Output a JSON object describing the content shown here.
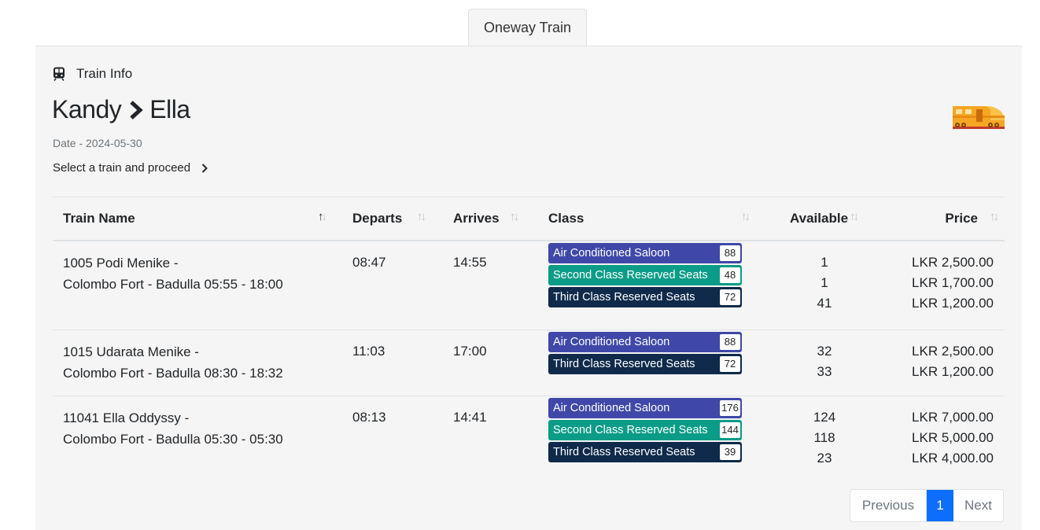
{
  "tab": {
    "label": "Oneway Train"
  },
  "info": {
    "title": "Train Info",
    "from": "Kandy",
    "to": "Ella",
    "date": "Date - 2024-05-30",
    "proceed": "Select a train and proceed"
  },
  "table": {
    "headers": {
      "train_name": "Train Name",
      "departs": "Departs",
      "arrives": "Arrives",
      "class": "Class",
      "available": "Available",
      "price": "Price"
    },
    "rows": [
      {
        "name_line1": "1005 Podi Menike -",
        "name_line2": "Colombo Fort - Badulla 05:55 - 18:00",
        "departs": "08:47",
        "arrives": "14:55",
        "classes": [
          {
            "name": "Air Conditioned Saloon",
            "count": "88",
            "color": "#3f48a8",
            "available": "1",
            "price": "LKR 2,500.00"
          },
          {
            "name": "Second Class Reserved Seats",
            "count": "48",
            "color": "#0b9c87",
            "available": "1",
            "price": "LKR 1,700.00"
          },
          {
            "name": "Third Class Reserved Seats",
            "count": "72",
            "color": "#0f2a4a",
            "available": "41",
            "price": "LKR 1,200.00"
          }
        ]
      },
      {
        "name_line1": "1015 Udarata Menike -",
        "name_line2": "Colombo Fort - Badulla 08:30 - 18:32",
        "departs": "11:03",
        "arrives": "17:00",
        "classes": [
          {
            "name": "Air Conditioned Saloon",
            "count": "88",
            "color": "#3f48a8",
            "available": "32",
            "price": "LKR 2,500.00"
          },
          {
            "name": "Third Class Reserved Seats",
            "count": "72",
            "color": "#0f2a4a",
            "available": "33",
            "price": "LKR 1,200.00"
          }
        ]
      },
      {
        "name_line1": "11041 Ella Oddyssy -",
        "name_line2": "Colombo Fort - Badulla 05:30 - 05:30",
        "departs": "08:13",
        "arrives": "14:41",
        "classes": [
          {
            "name": "Air Conditioned Saloon",
            "count": "176",
            "color": "#3f48a8",
            "available": "124",
            "price": "LKR 7,000.00"
          },
          {
            "name": "Second Class Reserved Seats",
            "count": "144",
            "color": "#0b9c87",
            "available": "118",
            "price": "LKR 5,000.00"
          },
          {
            "name": "Third Class Reserved Seats",
            "count": "39",
            "color": "#0f2a4a",
            "available": "23",
            "price": "LKR 4,000.00"
          }
        ]
      }
    ]
  },
  "pagination": {
    "previous": "Previous",
    "current": "1",
    "next": "Next"
  },
  "icons": {
    "train": "train-front-icon",
    "chevron": "chevron-right-icon",
    "illustration": "bullet-train-illustration",
    "sort": "sort-arrows-icon"
  }
}
